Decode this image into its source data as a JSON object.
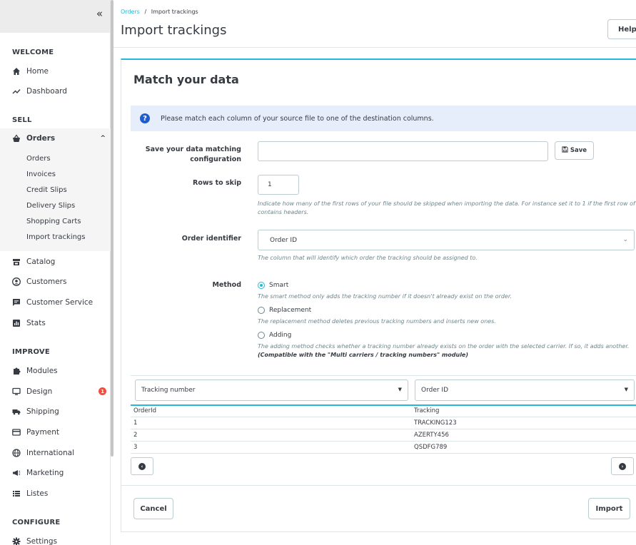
{
  "sidebar": {
    "collapse_icon": "«",
    "sections": {
      "welcome": "WELCOME",
      "sell": "SELL",
      "improve": "IMPROVE",
      "configure": "CONFIGURE"
    },
    "items": {
      "home": "Home",
      "dashboard": "Dashboard",
      "orders": "Orders",
      "catalog": "Catalog",
      "customers": "Customers",
      "customer_service": "Customer Service",
      "stats": "Stats",
      "modules": "Modules",
      "design": "Design",
      "shipping": "Shipping",
      "payment": "Payment",
      "international": "International",
      "marketing": "Marketing",
      "listes": "Listes",
      "settings": "Settings"
    },
    "orders_sub": {
      "orders": "Orders",
      "invoices": "Invoices",
      "credit_slips": "Credit Slips",
      "delivery_slips": "Delivery Slips",
      "shopping_carts": "Shopping Carts",
      "import_trackings": "Import trackings"
    },
    "design_badge": "1"
  },
  "header": {
    "breadcrumb_parent": "Orders",
    "breadcrumb_sep": "/",
    "breadcrumb_current": "Import trackings",
    "title": "Import trackings",
    "help": "Help"
  },
  "card": {
    "title": "Match your data",
    "info": "Please match each column of your source file to one of the destination columns.",
    "save_config_label_1": "Save your data matching",
    "save_config_label_2": "configuration",
    "save_config_value": "",
    "save_button": "Save",
    "rows_skip_label": "Rows to skip",
    "rows_skip_value": "1",
    "rows_skip_help_1": "Indicate how many of the first rows of your file should be skipped when importing the data. For instance set it to 1 if the first row of your file",
    "rows_skip_help_2": "contains headers.",
    "order_identifier_label": "Order identifier",
    "order_identifier_value": "Order ID",
    "order_identifier_help": "The column that will identify which order the tracking should be assigned to.",
    "method_label": "Method",
    "methods": [
      {
        "label": "Smart",
        "help": "The smart method only adds the tracking number if it doesn't already exist on the order.",
        "selected": true
      },
      {
        "label": "Replacement",
        "help": "The replacement method deletes previous tracking numbers and inserts new ones.",
        "selected": false
      },
      {
        "label": "Adding",
        "help": "The adding method checks whether a tracking number already exists on the order with the selected carrier. If so, it adds another.",
        "help_bold": "(Compatible with the \"Multi carriers / tracking numbers\" module)",
        "selected": false
      }
    ]
  },
  "mapping": {
    "col1_select": "Tracking number",
    "col2_select": "Order ID",
    "headers": [
      "OrderId",
      "Tracking"
    ],
    "rows": [
      [
        "1",
        "TRACKING123"
      ],
      [
        "2",
        "AZERTY456"
      ],
      [
        "3",
        "QSDFG789"
      ]
    ]
  },
  "footer": {
    "cancel": "Cancel",
    "import": "Import"
  },
  "colors": {
    "accent": "#25b9d7",
    "info_bg": "#e6eefc",
    "badge": "#f54c3e"
  }
}
